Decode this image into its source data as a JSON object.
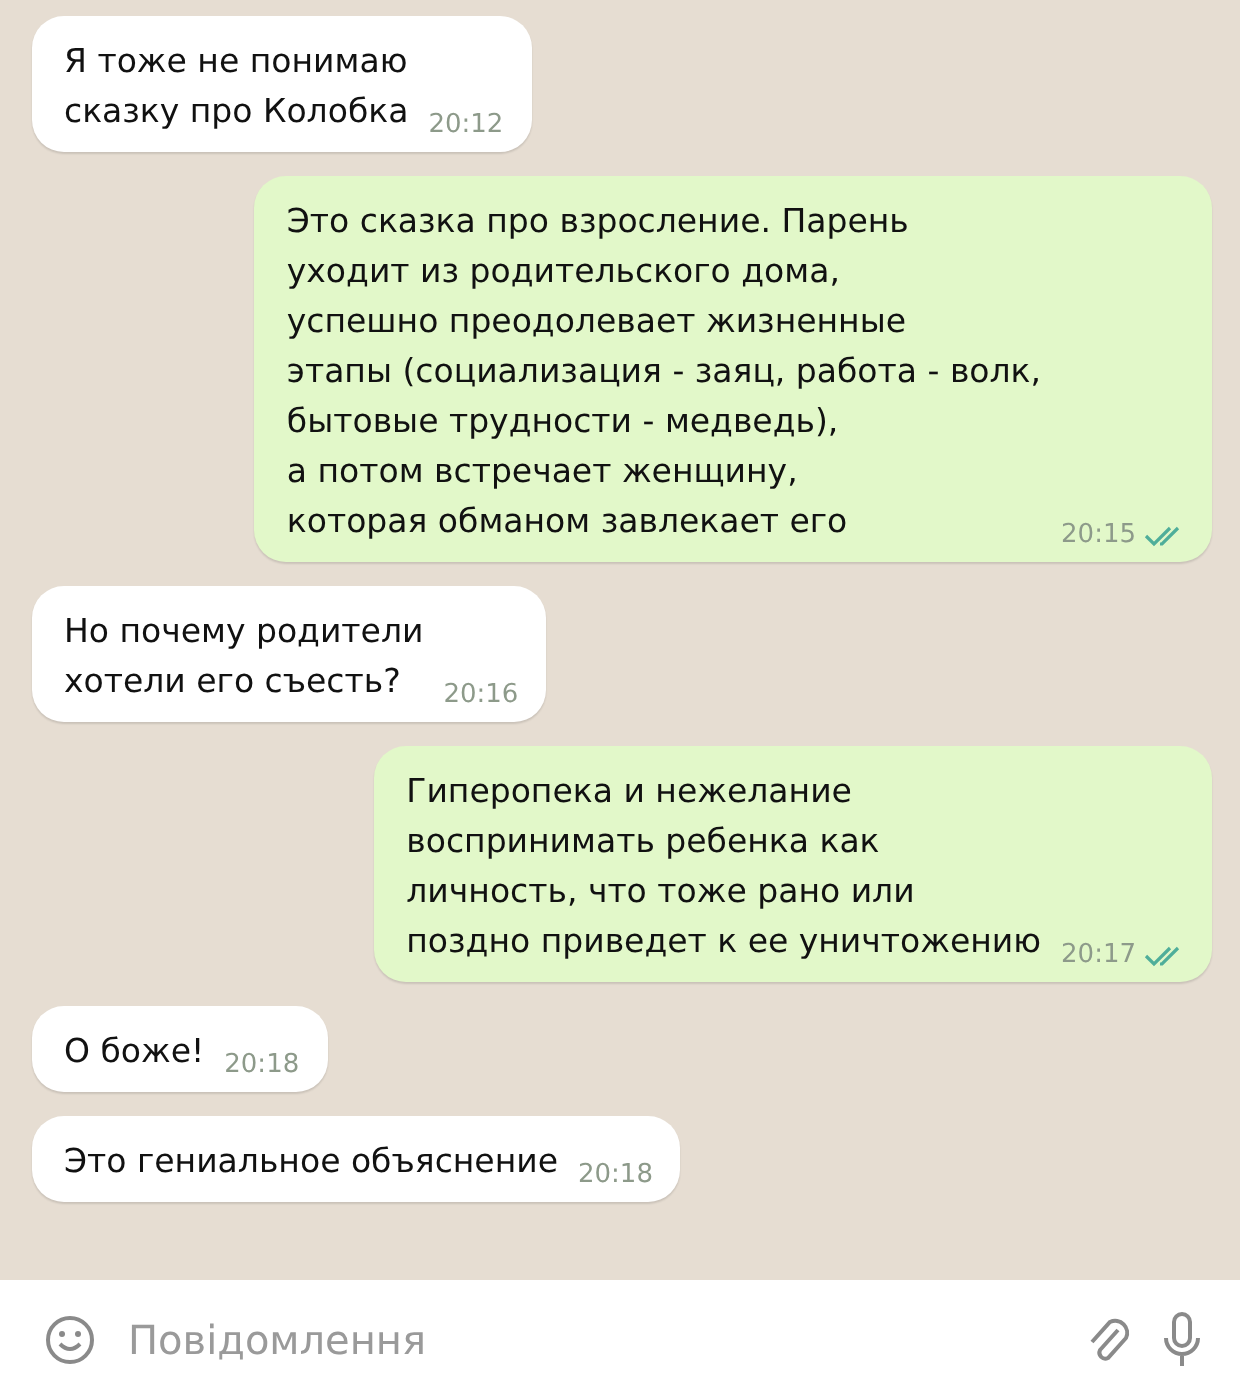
{
  "messages": [
    {
      "kind": "incoming",
      "text": "Я тоже не понимаю\nсказку про Колобка",
      "time": "20:12"
    },
    {
      "kind": "outgoing",
      "text": "Это сказка про взросление. Парень\nуходит из родительского дома,\nуспешно преодолевает жизненные\nэтапы (социализация - заяц, работа - волк,\nбытовые трудности - медведь),\nа потом встречает женщину,\nкоторая обманом завлекает его",
      "time": "20:15",
      "read": true
    },
    {
      "kind": "incoming",
      "text": "Но почему родители\nхотели его съесть?",
      "time": "20:16"
    },
    {
      "kind": "outgoing",
      "text": "Гиперопека и нежелание\nвоспринимать ребенка как\nличность, что тоже рано или\nпоздно приведет к ее уничтожению",
      "time": "20:17",
      "read": true
    },
    {
      "kind": "incoming",
      "text": "О боже!",
      "time": "20:18"
    },
    {
      "kind": "incoming",
      "text": "Это гениальное объяснение",
      "time": "20:18"
    }
  ],
  "composer": {
    "placeholder": "Повідомлення"
  }
}
